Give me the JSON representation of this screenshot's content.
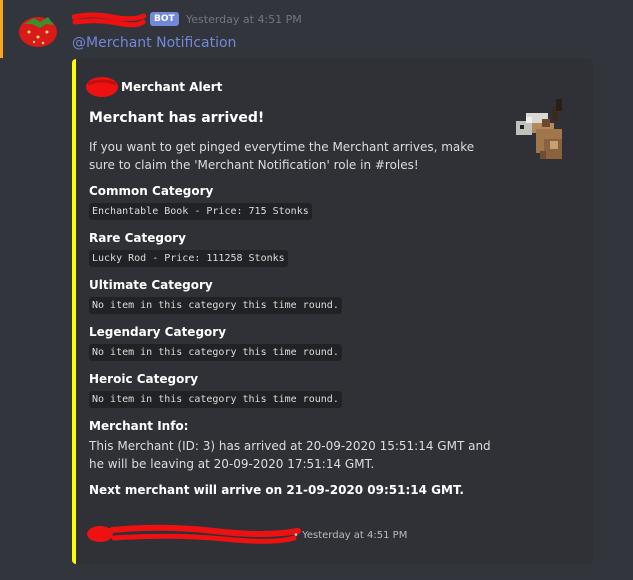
{
  "message": {
    "bot_tag": "BOT",
    "timestamp": "Yesterday at 4:51 PM",
    "mention": "@Merchant Notification"
  },
  "embed": {
    "author": "Merchant Alert",
    "title": "Merchant has arrived!",
    "description": "If you want to get pinged everytime the Merchant arrives, make sure to claim the 'Merchant Notification' role in #roles!",
    "fields": [
      {
        "name": "Common Category",
        "value": "Enchantable Book - Price: 715 Stonks"
      },
      {
        "name": "Rare Category",
        "value": "Lucky Rod - Price: 111258 Stonks"
      },
      {
        "name": "Ultimate Category",
        "value": "No item in this category this time round."
      },
      {
        "name": "Legendary Category",
        "value": "No item in this category this time round."
      },
      {
        "name": "Heroic Category",
        "value": "No item in this category this time round."
      }
    ],
    "info": {
      "name": "Merchant Info:",
      "value": "This Merchant (ID: 3) has arrived at 20-09-2020 15:51:14 GMT and he will be leaving at 20-09-2020 17:51:14 GMT."
    },
    "next": "Next merchant will arrive on 21-09-2020 09:51:14 GMT.",
    "footer": "• Yesterday at 4:51 PM"
  },
  "colors": {
    "background": "#32353b",
    "embed_background": "#2f3136",
    "embed_accent": "#fdfd05",
    "mention_bar": "#faa61a",
    "mention_text": "#7289da",
    "bot_tag": "#7289da",
    "redaction": "#ee1111"
  },
  "icons": {
    "avatar": "strawberry-avatar",
    "author_icon": "redacted-icon",
    "thumbnail": "llama-thumbnail"
  }
}
